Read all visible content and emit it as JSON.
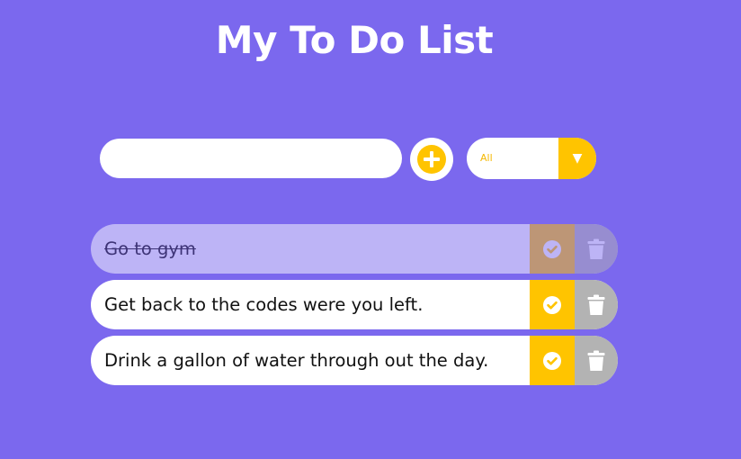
{
  "app": {
    "title": "My To Do List"
  },
  "form": {
    "input_value": "",
    "filter_selected": "All"
  },
  "colors": {
    "background": "#7b68ee",
    "accent": "#ffc400",
    "trash": "#b3b3b3"
  },
  "todos": [
    {
      "text": "Go to gym",
      "completed": true
    },
    {
      "text": "Get back to the codes were you left.",
      "completed": false
    },
    {
      "text": "Drink a gallon of water through out the day.",
      "completed": false
    }
  ]
}
